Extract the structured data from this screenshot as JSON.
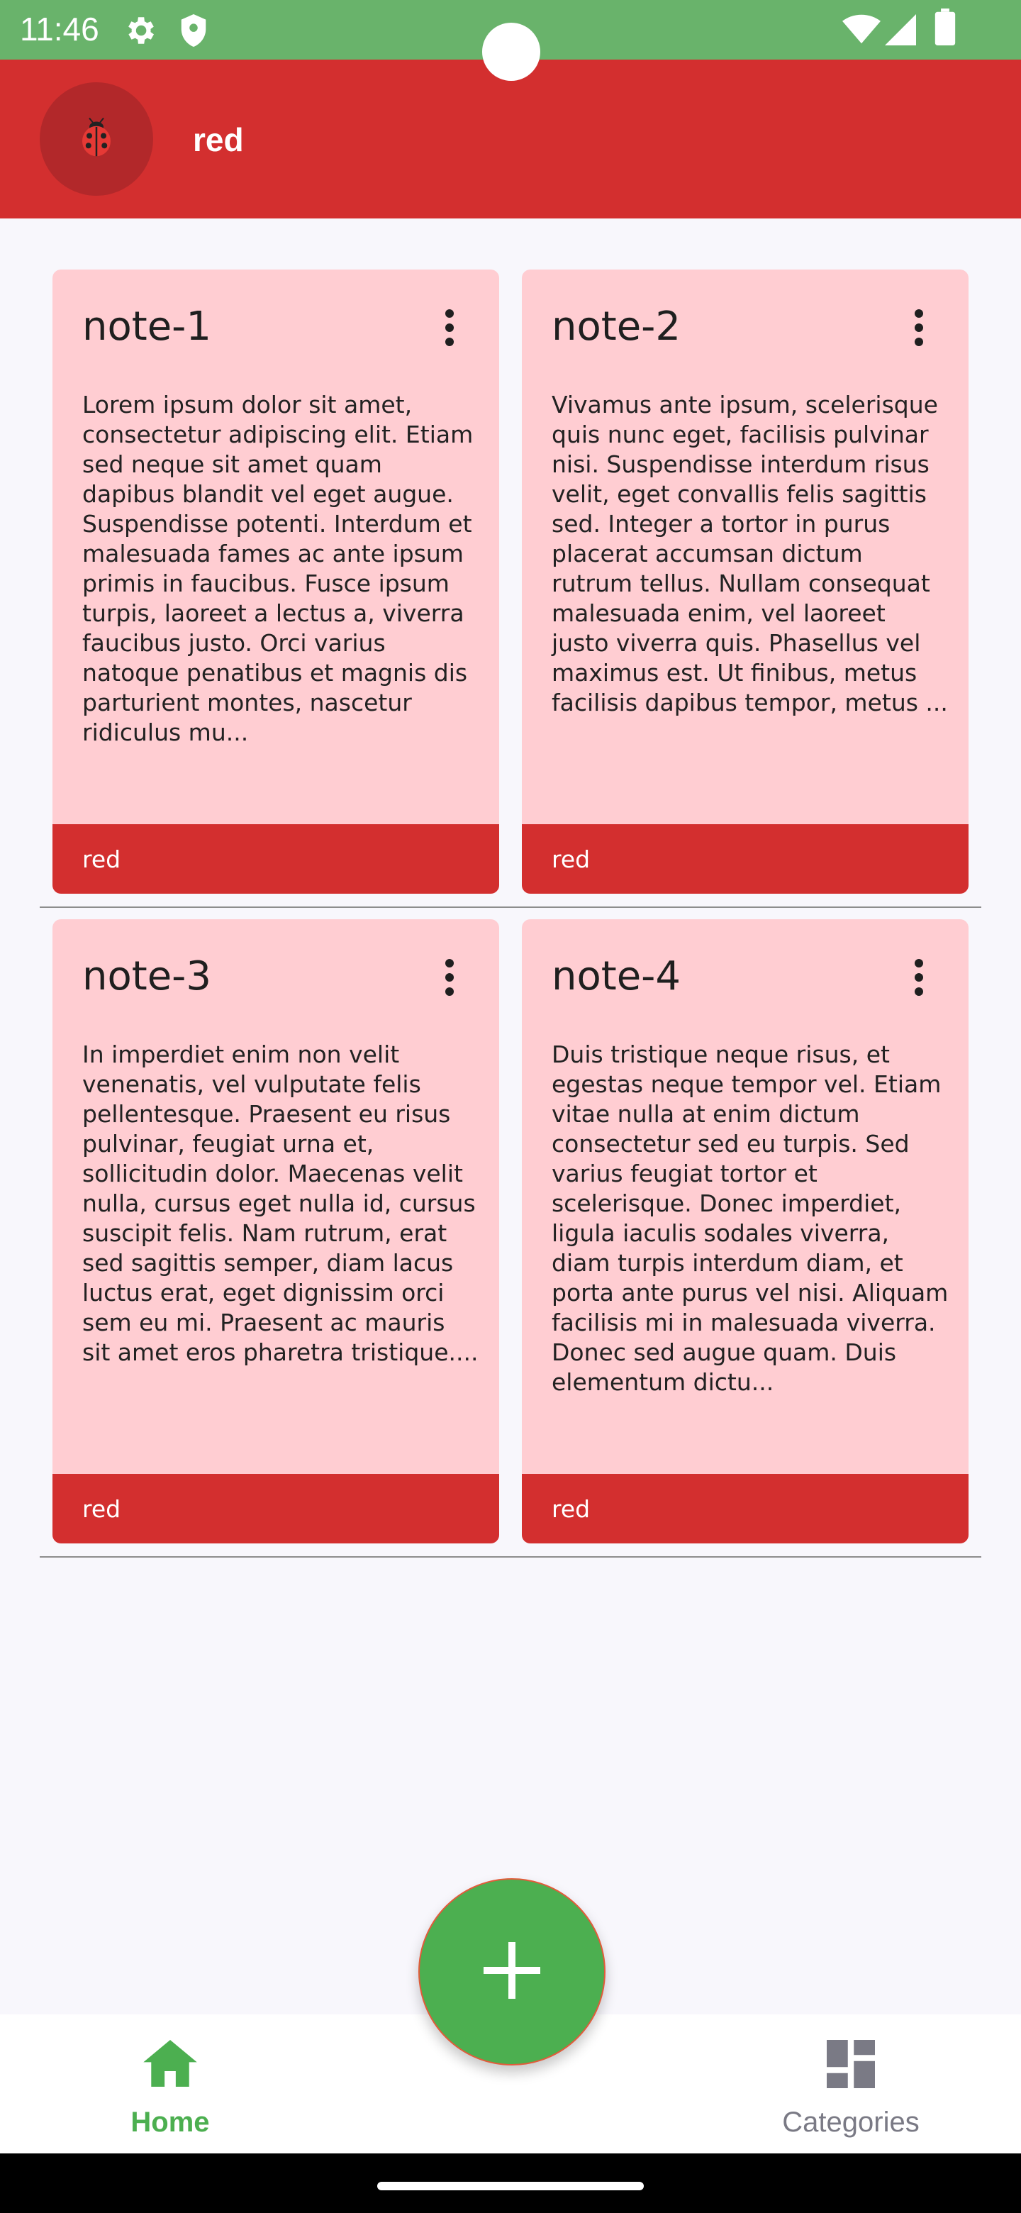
{
  "status_bar": {
    "time": "11:46",
    "icons": [
      "settings-icon",
      "shield-icon",
      "wifi-icon",
      "signal-icon",
      "battery-icon"
    ],
    "color": "#69b36b"
  },
  "app_bar": {
    "title": "red",
    "avatar_icon": "ladybug-icon",
    "color": "#d32f2f"
  },
  "notes": [
    {
      "title": "note-1",
      "body": "Lorem ipsum dolor sit amet, consectetur adipiscing elit. Etiam sed neque sit amet quam dapibus blandit vel eget augue. Suspendisse potenti. Interdum et malesuada fames ac ante ipsum primis in faucibus. Fusce ipsum turpis, laoreet a lectus a, viverra faucibus justo. Orci varius natoque penatibus et magnis dis parturient montes, nascetur ridiculus mu...",
      "category": "red"
    },
    {
      "title": "note-2",
      "body": "Vivamus ante ipsum, scelerisque quis nunc eget, facilisis pulvinar nisi. Suspendisse interdum risus velit, eget convallis felis sagittis sed. Integer a tortor in purus placerat accumsan dictum rutrum tellus. Nullam consequat malesuada enim, vel laoreet justo viverra quis. Phasellus vel maximus est. Ut finibus, metus facilisis dapibus tempor, metus ...",
      "category": "red"
    },
    {
      "title": "note-3",
      "body": "In imperdiet enim non velit venenatis, vel vulputate felis pellentesque. Praesent eu risus pulvinar, feugiat urna et, sollicitudin dolor. Maecenas velit nulla, cursus eget nulla id, cursus suscipit felis. Nam rutrum, erat sed sagittis semper, diam lacus luctus erat, eget dignissim orci sem eu mi. Praesent ac mauris sit amet eros pharetra tristique....",
      "category": "red"
    },
    {
      "title": "note-4",
      "body": "Duis tristique neque risus, et egestas neque tempor vel. Etiam vitae nulla at enim dictum consectetur sed eu turpis. Sed varius feugiat tortor et scelerisque. Donec imperdiet, ligula iaculis sodales viverra, diam turpis interdum diam, et porta ante purus vel nisi. Aliquam facilisis mi in malesuada viverra. Donec sed augue quam. Duis elementum dictu...",
      "category": "red"
    }
  ],
  "fab": {
    "icon": "plus-icon",
    "color": "#4caf50"
  },
  "bottom_nav": {
    "home_label": "Home",
    "categories_label": "Categories",
    "active_color": "#4caf50",
    "inactive_color": "#7a7a85"
  },
  "colors": {
    "card_bg": "#ffcdd2",
    "card_footer": "#d32f2f",
    "page_bg": "#f8f7fc"
  }
}
